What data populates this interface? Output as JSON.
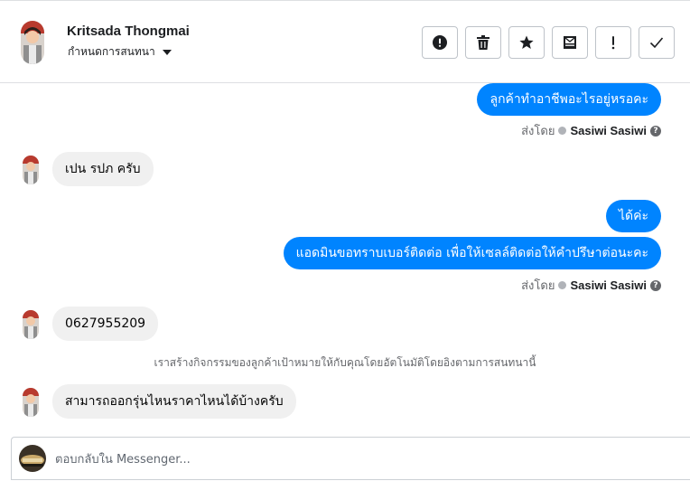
{
  "header": {
    "name": "Kritsada Thongmai",
    "subtitle": "กำหนดการสนทนา"
  },
  "toolbar": {
    "buttons": [
      {
        "icon": "alert-circle-icon"
      },
      {
        "icon": "trash-icon"
      },
      {
        "icon": "star-icon"
      },
      {
        "icon": "mark-unread-icon"
      },
      {
        "icon": "exclamation-icon"
      },
      {
        "icon": "checkmark-icon"
      }
    ]
  },
  "messages": {
    "m1_text": "ลูกค้าทำอาชีพอะไรอยู่หรอคะ",
    "m1_sent_prefix": "ส่งโดย",
    "m1_sent_by": "Sasiwi Sasiwi",
    "m2_text": "เปน รปภ ครับ",
    "m3_text": "ได้ค่ะ",
    "m4_text": "แอดมินขอทราบเบอร์ติดต่อ เพื่อให้เซลล์ติดต่อให้คำปรึษาต่อนะคะ",
    "m4_sent_prefix": "ส่งโดย",
    "m4_sent_by": "Sasiwi Sasiwi",
    "m5_text": "0627955209",
    "system_note": "เราสร้างกิจกรรมของลูกค้าเป้าหมายให้กับคุณโดยอัตโนมัติโดยอิงตามการสนทนานี้",
    "m6_text": "สามารถออกรุ่นไหนราคาไหนได้บ้างครับ"
  },
  "composer": {
    "placeholder": "ตอบกลับใน Messenger..."
  },
  "colors": {
    "outgoing_bubble": "#0084ff",
    "incoming_bubble": "#f0f0f0"
  }
}
